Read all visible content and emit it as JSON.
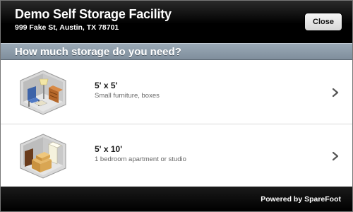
{
  "header": {
    "title": "Demo Self Storage Facility",
    "address": "999 Fake St, Austin, TX 78701",
    "close_label": "Close"
  },
  "question": "How much storage do you need?",
  "sizes": [
    {
      "size": "5' x 5'",
      "description": "Small furniture, boxes",
      "icon": "storage-unit-5x5-icon",
      "chevron": "chevron-right-icon"
    },
    {
      "size": "5' x 10'",
      "description": "1 bedroom apartment or studio",
      "icon": "storage-unit-5x10-icon",
      "chevron": "chevron-right-icon"
    }
  ],
  "footer": {
    "powered_by": "Powered by SpareFoot"
  },
  "colors": {
    "header_bg": "#000000",
    "question_bar": "#8e9caa",
    "list_bg": "#ffffff",
    "footer_bg": "#000000"
  }
}
